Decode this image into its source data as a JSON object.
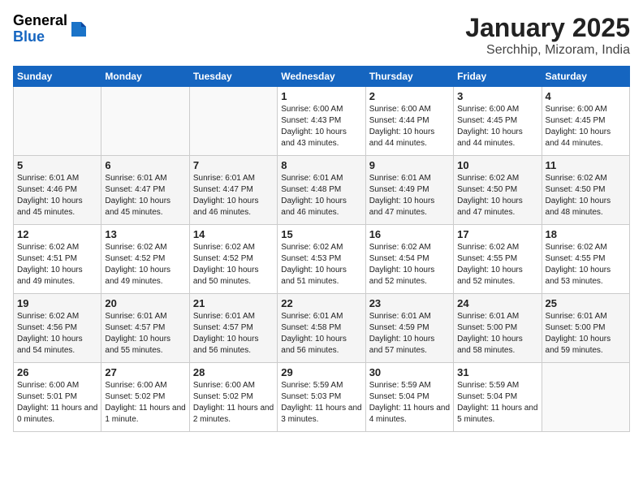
{
  "header": {
    "logo_general": "General",
    "logo_blue": "Blue",
    "month_title": "January 2025",
    "location": "Serchhip, Mizoram, India"
  },
  "days_of_week": [
    "Sunday",
    "Monday",
    "Tuesday",
    "Wednesday",
    "Thursday",
    "Friday",
    "Saturday"
  ],
  "weeks": [
    [
      {
        "day": "",
        "info": ""
      },
      {
        "day": "",
        "info": ""
      },
      {
        "day": "",
        "info": ""
      },
      {
        "day": "1",
        "info": "Sunrise: 6:00 AM\nSunset: 4:43 PM\nDaylight: 10 hours and 43 minutes."
      },
      {
        "day": "2",
        "info": "Sunrise: 6:00 AM\nSunset: 4:44 PM\nDaylight: 10 hours and 44 minutes."
      },
      {
        "day": "3",
        "info": "Sunrise: 6:00 AM\nSunset: 4:45 PM\nDaylight: 10 hours and 44 minutes."
      },
      {
        "day": "4",
        "info": "Sunrise: 6:00 AM\nSunset: 4:45 PM\nDaylight: 10 hours and 44 minutes."
      }
    ],
    [
      {
        "day": "5",
        "info": "Sunrise: 6:01 AM\nSunset: 4:46 PM\nDaylight: 10 hours and 45 minutes."
      },
      {
        "day": "6",
        "info": "Sunrise: 6:01 AM\nSunset: 4:47 PM\nDaylight: 10 hours and 45 minutes."
      },
      {
        "day": "7",
        "info": "Sunrise: 6:01 AM\nSunset: 4:47 PM\nDaylight: 10 hours and 46 minutes."
      },
      {
        "day": "8",
        "info": "Sunrise: 6:01 AM\nSunset: 4:48 PM\nDaylight: 10 hours and 46 minutes."
      },
      {
        "day": "9",
        "info": "Sunrise: 6:01 AM\nSunset: 4:49 PM\nDaylight: 10 hours and 47 minutes."
      },
      {
        "day": "10",
        "info": "Sunrise: 6:02 AM\nSunset: 4:50 PM\nDaylight: 10 hours and 47 minutes."
      },
      {
        "day": "11",
        "info": "Sunrise: 6:02 AM\nSunset: 4:50 PM\nDaylight: 10 hours and 48 minutes."
      }
    ],
    [
      {
        "day": "12",
        "info": "Sunrise: 6:02 AM\nSunset: 4:51 PM\nDaylight: 10 hours and 49 minutes."
      },
      {
        "day": "13",
        "info": "Sunrise: 6:02 AM\nSunset: 4:52 PM\nDaylight: 10 hours and 49 minutes."
      },
      {
        "day": "14",
        "info": "Sunrise: 6:02 AM\nSunset: 4:52 PM\nDaylight: 10 hours and 50 minutes."
      },
      {
        "day": "15",
        "info": "Sunrise: 6:02 AM\nSunset: 4:53 PM\nDaylight: 10 hours and 51 minutes."
      },
      {
        "day": "16",
        "info": "Sunrise: 6:02 AM\nSunset: 4:54 PM\nDaylight: 10 hours and 52 minutes."
      },
      {
        "day": "17",
        "info": "Sunrise: 6:02 AM\nSunset: 4:55 PM\nDaylight: 10 hours and 52 minutes."
      },
      {
        "day": "18",
        "info": "Sunrise: 6:02 AM\nSunset: 4:55 PM\nDaylight: 10 hours and 53 minutes."
      }
    ],
    [
      {
        "day": "19",
        "info": "Sunrise: 6:02 AM\nSunset: 4:56 PM\nDaylight: 10 hours and 54 minutes."
      },
      {
        "day": "20",
        "info": "Sunrise: 6:01 AM\nSunset: 4:57 PM\nDaylight: 10 hours and 55 minutes."
      },
      {
        "day": "21",
        "info": "Sunrise: 6:01 AM\nSunset: 4:57 PM\nDaylight: 10 hours and 56 minutes."
      },
      {
        "day": "22",
        "info": "Sunrise: 6:01 AM\nSunset: 4:58 PM\nDaylight: 10 hours and 56 minutes."
      },
      {
        "day": "23",
        "info": "Sunrise: 6:01 AM\nSunset: 4:59 PM\nDaylight: 10 hours and 57 minutes."
      },
      {
        "day": "24",
        "info": "Sunrise: 6:01 AM\nSunset: 5:00 PM\nDaylight: 10 hours and 58 minutes."
      },
      {
        "day": "25",
        "info": "Sunrise: 6:01 AM\nSunset: 5:00 PM\nDaylight: 10 hours and 59 minutes."
      }
    ],
    [
      {
        "day": "26",
        "info": "Sunrise: 6:00 AM\nSunset: 5:01 PM\nDaylight: 11 hours and 0 minutes."
      },
      {
        "day": "27",
        "info": "Sunrise: 6:00 AM\nSunset: 5:02 PM\nDaylight: 11 hours and 1 minute."
      },
      {
        "day": "28",
        "info": "Sunrise: 6:00 AM\nSunset: 5:02 PM\nDaylight: 11 hours and 2 minutes."
      },
      {
        "day": "29",
        "info": "Sunrise: 5:59 AM\nSunset: 5:03 PM\nDaylight: 11 hours and 3 minutes."
      },
      {
        "day": "30",
        "info": "Sunrise: 5:59 AM\nSunset: 5:04 PM\nDaylight: 11 hours and 4 minutes."
      },
      {
        "day": "31",
        "info": "Sunrise: 5:59 AM\nSunset: 5:04 PM\nDaylight: 11 hours and 5 minutes."
      },
      {
        "day": "",
        "info": ""
      }
    ]
  ]
}
